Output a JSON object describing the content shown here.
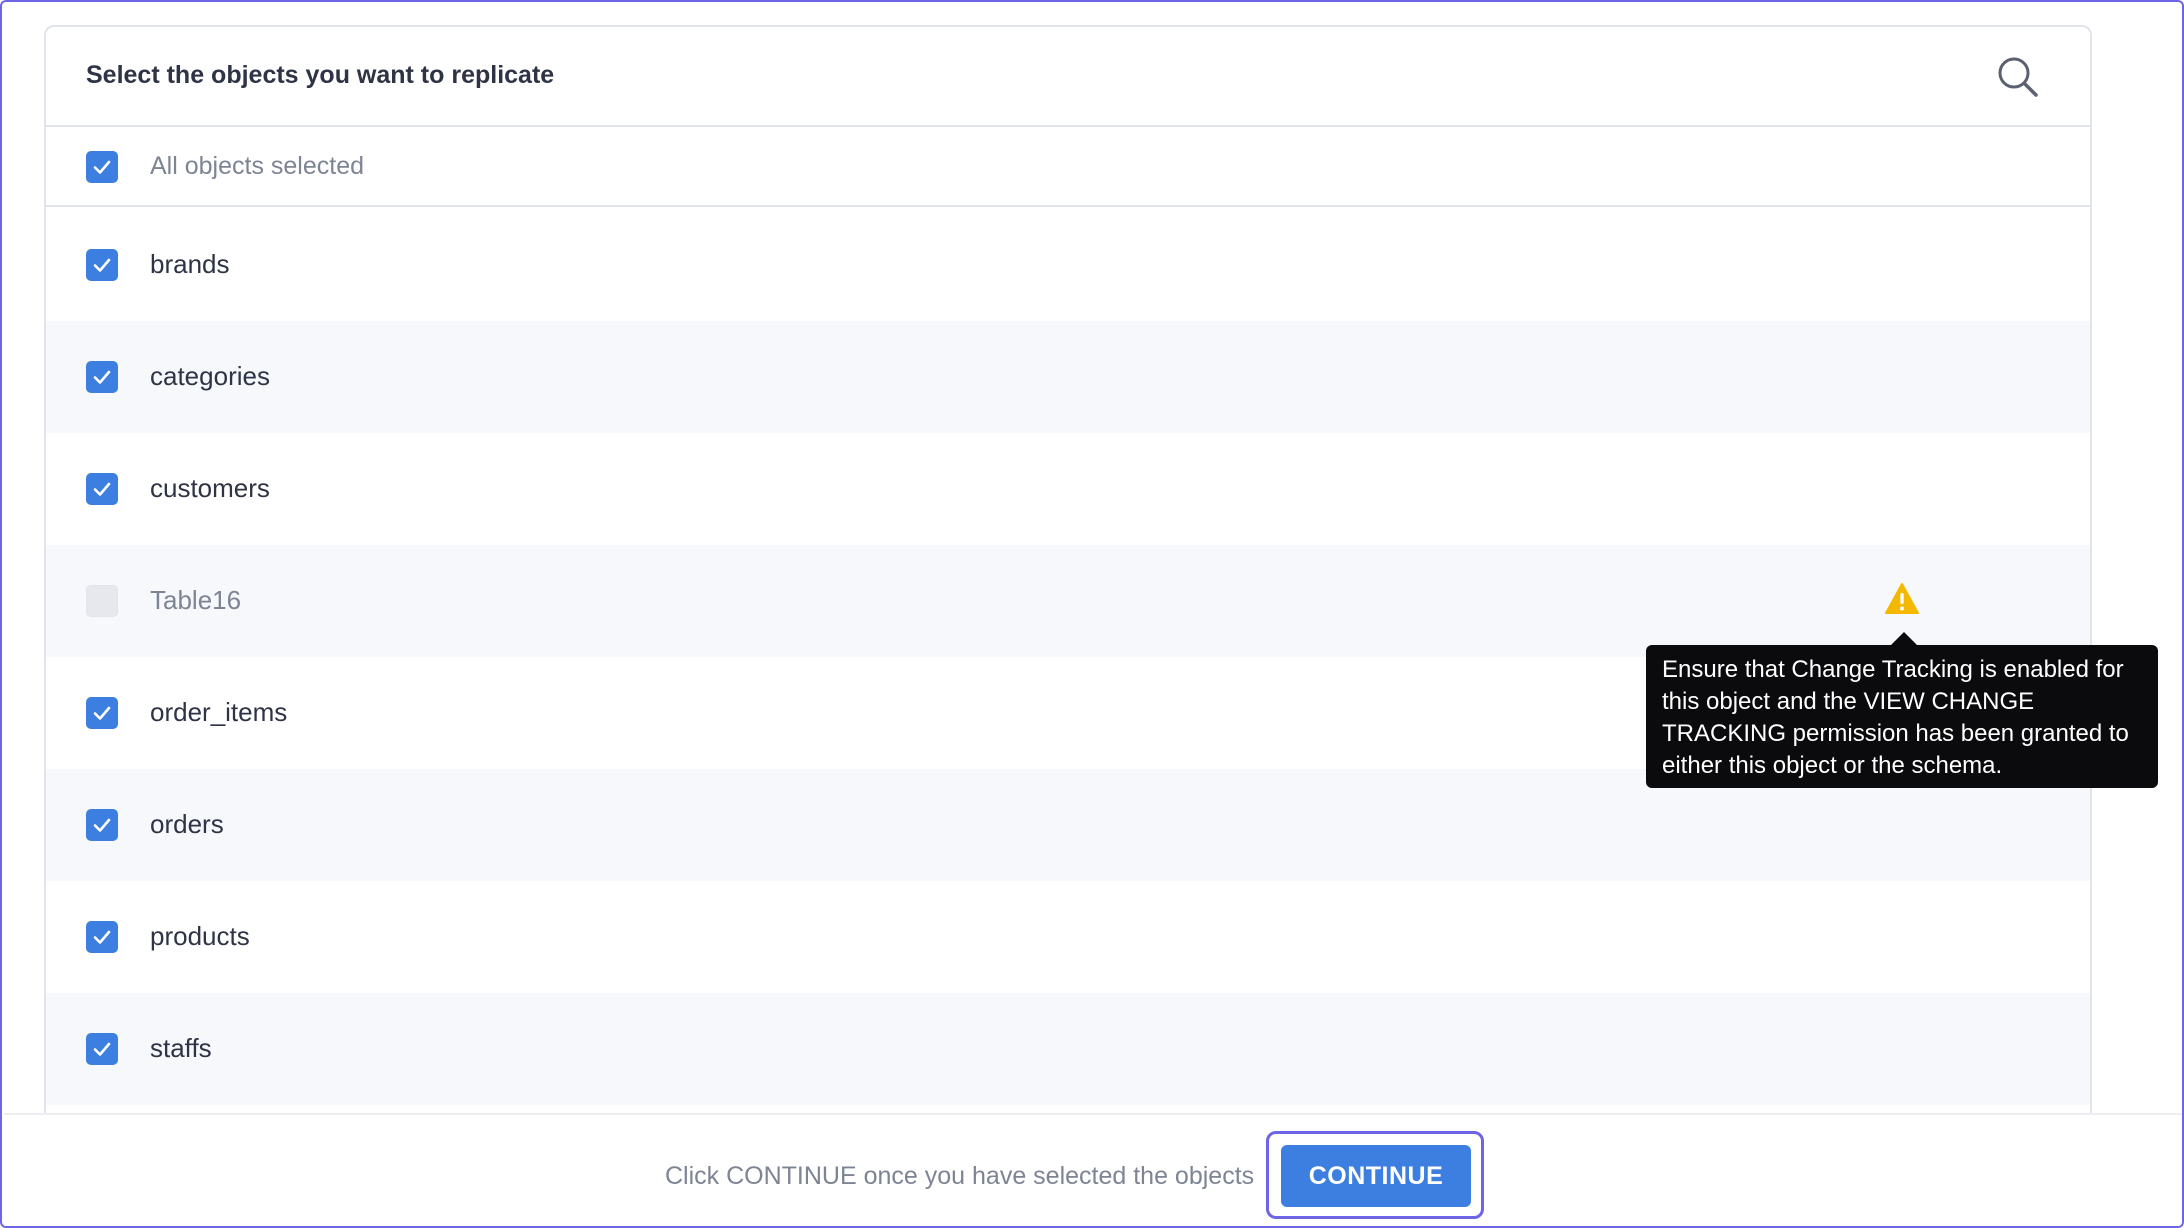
{
  "panel": {
    "title": "Select the objects you want to replicate",
    "search_icon": "search-icon"
  },
  "select_all": {
    "label": "All objects selected",
    "checked": true
  },
  "objects": [
    {
      "label": "brands",
      "checked": true,
      "enabled": true
    },
    {
      "label": "categories",
      "checked": true,
      "enabled": true
    },
    {
      "label": "customers",
      "checked": true,
      "enabled": true
    },
    {
      "label": "Table16",
      "checked": false,
      "enabled": false,
      "warning": true
    },
    {
      "label": "order_items",
      "checked": true,
      "enabled": true
    },
    {
      "label": "orders",
      "checked": true,
      "enabled": true
    },
    {
      "label": "products",
      "checked": true,
      "enabled": true
    },
    {
      "label": "staffs",
      "checked": true,
      "enabled": true
    }
  ],
  "tooltip": {
    "text": "Ensure that Change Tracking is enabled for this object and the VIEW CHANGE TRACKING permission has been granted to either this object or the schema."
  },
  "footer": {
    "hint": "Click CONTINUE once you have selected the objects",
    "continue_label": "CONTINUE"
  },
  "colors": {
    "accent": "#3d7fe0",
    "focus_ring": "#6e64e6",
    "warning": "#f5b800",
    "tooltip_bg": "#0b0b0d"
  }
}
